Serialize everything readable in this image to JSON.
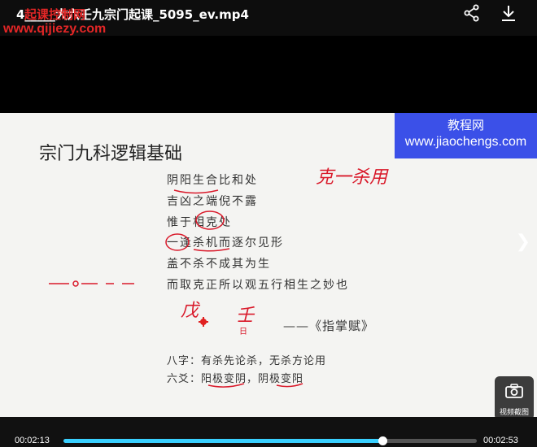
{
  "window": {
    "title": "4_____大六壬九宗门起课_5095_ev.mp4",
    "overlay_text": "起课控制网",
    "site_watermark": "www.qijiezy.com"
  },
  "toolbar": {
    "share_icon": "share-icon",
    "download_icon": "download-icon"
  },
  "slide": {
    "title": "宗门九科逻辑基础",
    "watermark_line1": "教程网",
    "watermark_line2": "www.jiaochengs.com",
    "poem_lines": [
      "阴阳生合比和处",
      "吉凶之端倪不露",
      "惟于相克处",
      "一逢杀机而逐尔见形",
      "盖不杀不成其为生",
      "而取克正所以观五行相生之妙也"
    ],
    "attribution": "——《指掌赋》",
    "bazi_line": "八字：有杀先论杀，无杀方论用",
    "liuyao_line": "六爻：阳极变阴，阴极变阳"
  },
  "handwriting": {
    "top_right": "克一杀用",
    "mid_left_1": "戊",
    "mid_left_2": "壬"
  },
  "screenshot": {
    "label": "视频截图"
  },
  "player": {
    "current_time": "00:02:13",
    "total_time": "00:02:53",
    "progress": 0.772
  },
  "colors": {
    "accent": "#39d0ff",
    "annotation": "#d9192a",
    "watermark_bg": "#3b50e8"
  }
}
